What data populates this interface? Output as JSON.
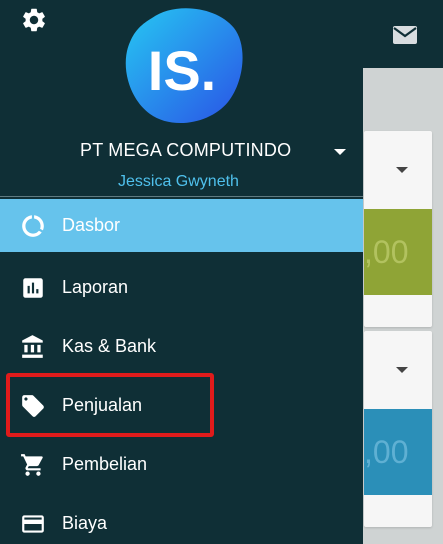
{
  "app": {
    "card1_amount": ",00",
    "card2_amount": ",00"
  },
  "drawer": {
    "logo_text": "IS.",
    "company_name": "PT MEGA COMPUTINDO",
    "user_name": "Jessica Gwyneth",
    "menu": [
      {
        "label": "Dasbor",
        "icon": "donut-chart-icon",
        "active": true
      },
      {
        "label": "Laporan",
        "icon": "bar-chart-icon",
        "active": false
      },
      {
        "label": "Kas & Bank",
        "icon": "bank-icon",
        "active": false
      },
      {
        "label": "Penjualan",
        "icon": "tag-icon",
        "active": false
      },
      {
        "label": "Pembelian",
        "icon": "cart-icon",
        "active": false
      },
      {
        "label": "Biaya",
        "icon": "credit-card-icon",
        "active": false
      }
    ]
  },
  "colors": {
    "drawer_bg": "#0f2f36",
    "active_bg": "#66c3ec",
    "user_name": "#4fc0ec",
    "highlight_border": "#e01b1b"
  }
}
